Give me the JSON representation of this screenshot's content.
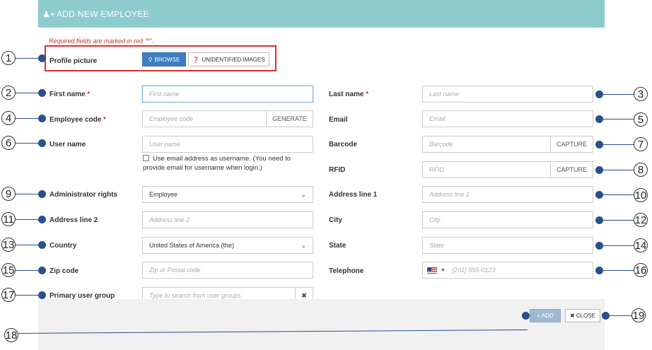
{
  "header": {
    "title": "ADD NEW EMPLOYEE",
    "icon": "user-plus-icon"
  },
  "form": {
    "required_note": "Required fields are marked in red \"*\".",
    "required_star": "*",
    "profile_picture": {
      "label": "Profile picture",
      "browse": "BROWSE",
      "unidentified": "UNIDENTIFIED IMAGES"
    },
    "first_name": {
      "label": "First name",
      "placeholder": "First name"
    },
    "last_name": {
      "label": "Last name",
      "placeholder": "Last name"
    },
    "employee_code": {
      "label": "Employee code",
      "placeholder": "Employee code",
      "button": "GENERATE"
    },
    "email": {
      "label": "Email",
      "placeholder": "Email"
    },
    "user_name": {
      "label": "User name",
      "placeholder": "User name",
      "checkbox_text": "Use email address as username. (You need to provide email for username when login.)"
    },
    "barcode": {
      "label": "Barcode",
      "placeholder": "Barcode",
      "button": "CAPTURE"
    },
    "rfid": {
      "label": "RFID",
      "placeholder": "RFID",
      "button": "CAPTURE"
    },
    "admin_rights": {
      "label": "Administrator rights",
      "value": "Employee"
    },
    "address1": {
      "label": "Address line 1",
      "placeholder": "Address line 1"
    },
    "address2": {
      "label": "Address line 2",
      "placeholder": "Address line 2"
    },
    "city": {
      "label": "City",
      "placeholder": "City"
    },
    "country": {
      "label": "Country",
      "value": "United States of America (the)"
    },
    "state": {
      "label": "State",
      "placeholder": "State"
    },
    "zip": {
      "label": "Zip code",
      "placeholder": "Zip or Postal code"
    },
    "telephone": {
      "label": "Telephone",
      "placeholder": "(201) 555-0123"
    },
    "user_group": {
      "label": "Primary user group",
      "placeholder": "Type to search from user groups"
    }
  },
  "footer": {
    "add": "ADD",
    "close": "CLOSE"
  },
  "callouts": [
    "1",
    "2",
    "3",
    "4",
    "5",
    "6",
    "7",
    "8",
    "9",
    "10",
    "11",
    "12",
    "13",
    "14",
    "15",
    "16",
    "17",
    "18",
    "19"
  ],
  "colors": {
    "header": "#8ecbcd",
    "primary": "#3c7ec0",
    "required": "#c0392b",
    "highlight": "#e03030",
    "callout": "#2a4f8f"
  }
}
